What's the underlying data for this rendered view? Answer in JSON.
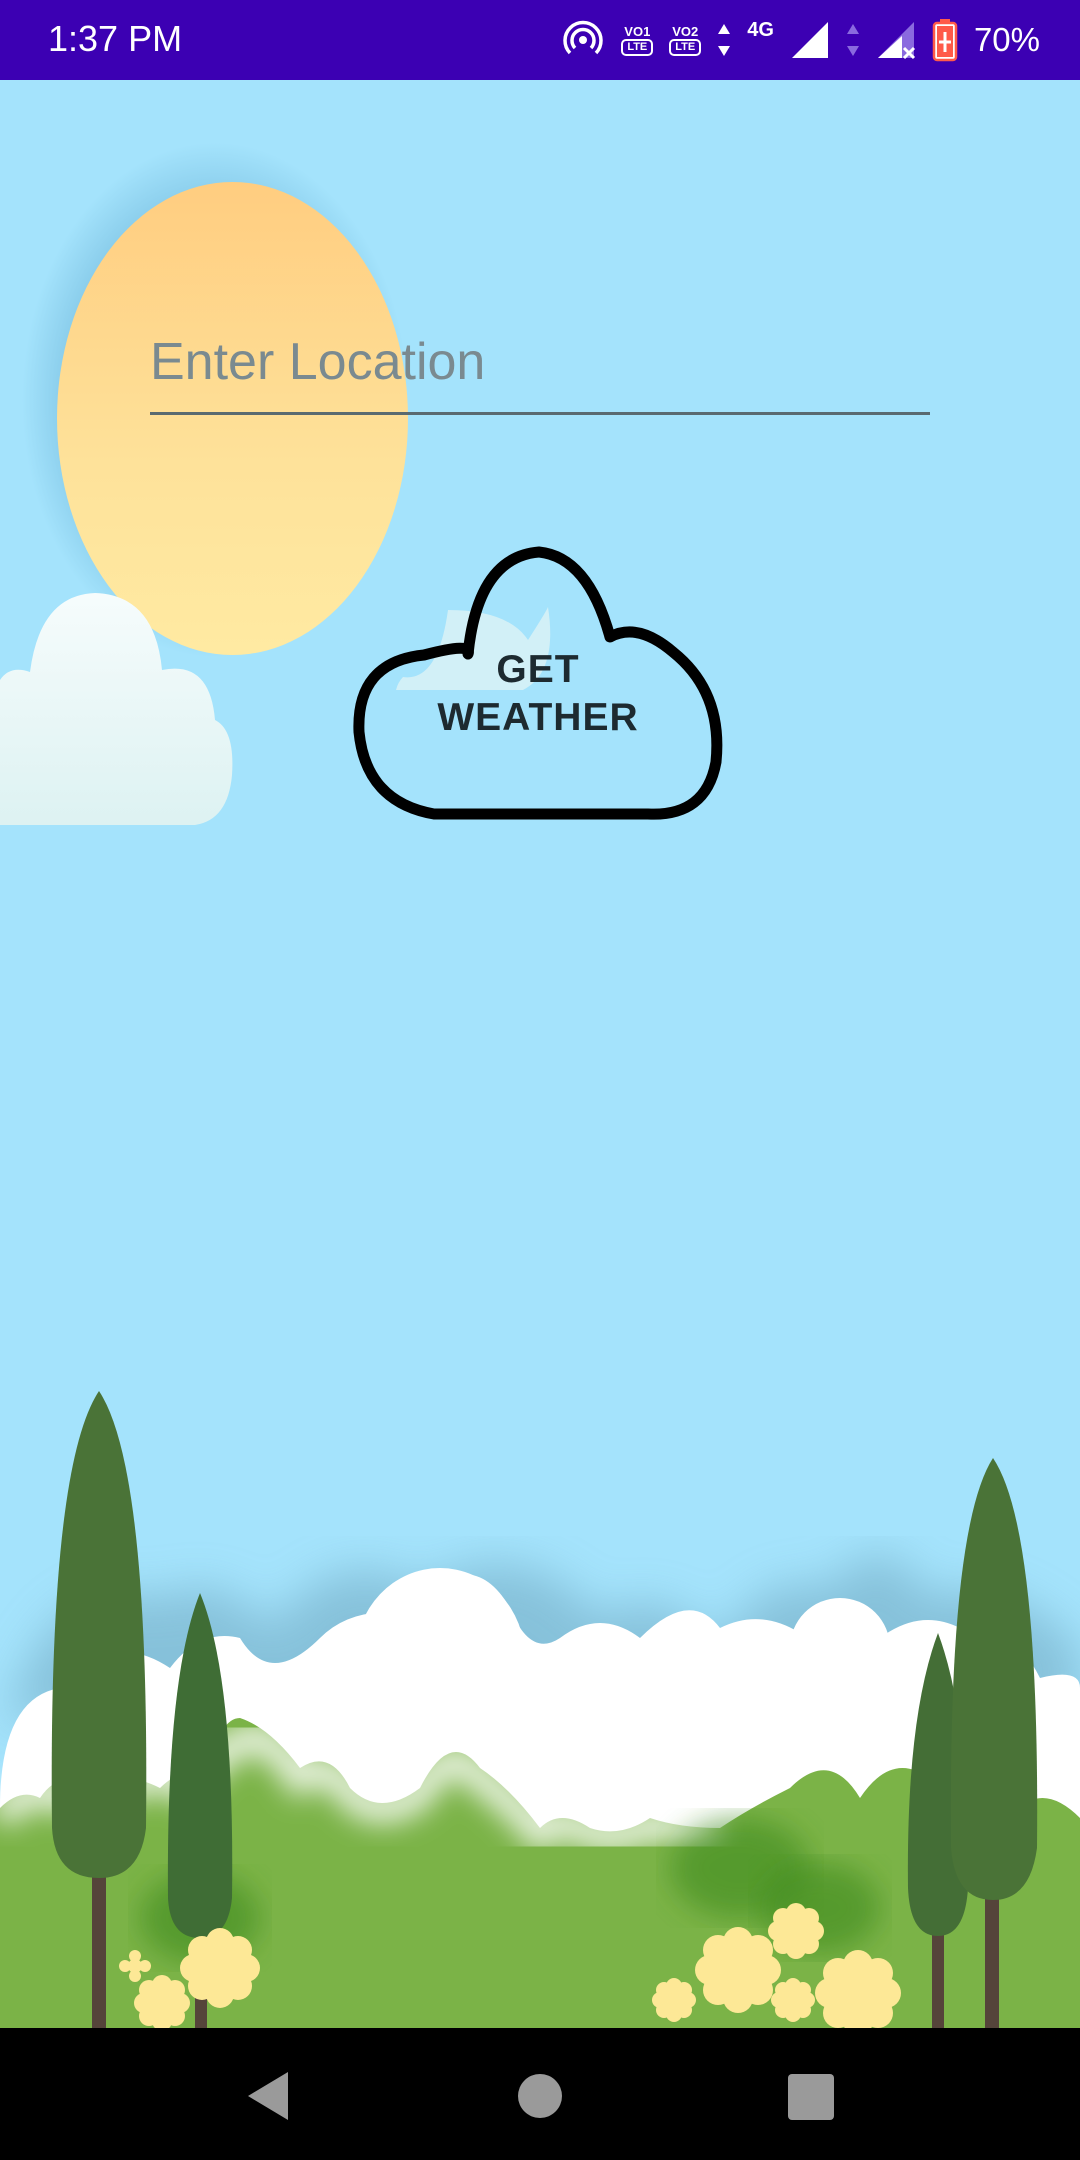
{
  "status_bar": {
    "time": "1:37 PM",
    "volte1_top": "VO1",
    "volte2_top": "VO2",
    "lte": "LTE",
    "network": "4G",
    "battery": "70%",
    "icons": [
      "hotspot-icon",
      "volte-sim1-icon",
      "volte-sim2-icon",
      "data-arrows-icon",
      "signal-icon",
      "no-signal-icon",
      "battery-icon"
    ]
  },
  "location_input": {
    "placeholder": "Enter Location",
    "value": ""
  },
  "get_weather_button": {
    "label": "GET WEATHER"
  },
  "nav_bar": {
    "icons": [
      "back-icon",
      "home-icon",
      "recents-icon"
    ]
  },
  "colors": {
    "sky": "#a4e3fc",
    "status_bar": "#3c00b3",
    "sun": "#ffd98a",
    "grass": "#7bb347",
    "tree": "#4a7337"
  }
}
